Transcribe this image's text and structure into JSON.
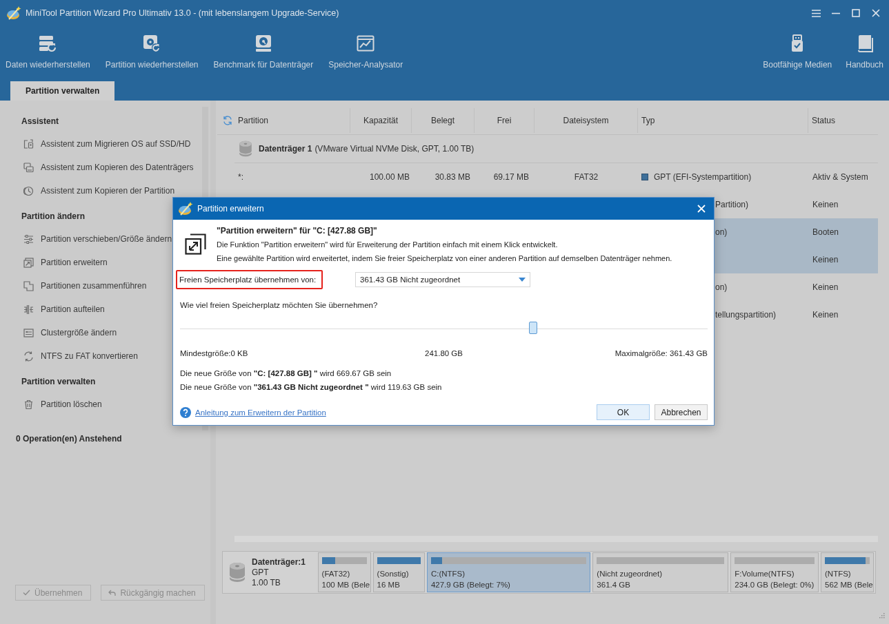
{
  "window": {
    "title": "MiniTool Partition Wizard Pro Ultimativ 13.0 - (mit lebenslangem Upgrade-Service)"
  },
  "toolbar": {
    "left": [
      {
        "label": "Daten wiederherstellen",
        "kind": "data"
      },
      {
        "label": "Partition wiederherstellen",
        "kind": "partition"
      },
      {
        "label": "Benchmark für Datenträger",
        "kind": "benchmark"
      },
      {
        "label": "Speicher-Analysator",
        "kind": "analyzer"
      }
    ],
    "right": [
      {
        "label": "Bootfähige Medien",
        "kind": "bootable"
      },
      {
        "label": "Handbuch",
        "kind": "manual"
      }
    ]
  },
  "tabs": [
    {
      "label": "Partition verwalten",
      "selected": true
    }
  ],
  "sidebar": {
    "sections": [
      {
        "title": "Assistent",
        "items": [
          {
            "label": "Assistent zum Migrieren OS auf SSD/HD",
            "kind": "migrate"
          },
          {
            "label": "Assistent zum Kopieren des Datenträgers",
            "kind": "copy-disk"
          },
          {
            "label": "Assistent zum Kopieren der Partition",
            "kind": "copy-partition"
          }
        ]
      },
      {
        "title": "Partition ändern",
        "items": [
          {
            "label": "Partition verschieben/Größe ändern",
            "kind": "move-resize"
          },
          {
            "label": "Partition erweitern",
            "kind": "extend"
          },
          {
            "label": "Partitionen zusammenführen",
            "kind": "merge"
          },
          {
            "label": "Partition aufteilen",
            "kind": "split"
          },
          {
            "label": "Clustergröße ändern",
            "kind": "cluster"
          },
          {
            "label": "NTFS zu FAT konvertieren",
            "kind": "convert"
          }
        ]
      },
      {
        "title": "Partition verwalten",
        "items": [
          {
            "label": "Partition löschen",
            "kind": "delete"
          }
        ]
      }
    ],
    "pending": "0 Operation(en) Anstehend",
    "buttons": [
      {
        "label": "Übernehmen",
        "kind": "apply",
        "disabled": true
      },
      {
        "label": "Rückgängig machen",
        "kind": "undo",
        "disabled": true
      }
    ]
  },
  "table": {
    "columns": [
      "Partition",
      "Kapazität",
      "Belegt",
      "Frei",
      "Dateisystem",
      "Typ",
      "Status"
    ],
    "disk": {
      "name": "Datenträger 1",
      "detail": "(VMware Virtual NVMe Disk, GPT, 1.00 TB)"
    },
    "rows": [
      {
        "partition": "*:",
        "capacity": "100.00 MB",
        "used": "30.83 MB",
        "free": "69.17 MB",
        "filesystem": "FAT32",
        "type": "GPT (EFI-Systempartition)",
        "status": "Aktiv & System",
        "selected": false
      },
      {
        "type": "Partition)",
        "status": "Keinen",
        "selected": false
      },
      {
        "type": "on)",
        "status": "Booten",
        "selected": true
      },
      {
        "status": "Keinen",
        "selected": true
      },
      {
        "type": "on)",
        "status": "Keinen",
        "selected": false
      },
      {
        "type": "tellungspartition)",
        "status": "Keinen",
        "selected": false
      }
    ]
  },
  "disk_map": {
    "name": "Datenträger:1",
    "scheme": "GPT",
    "size": "1.00 TB",
    "partitions": [
      {
        "label": "(FAT32)",
        "detail": "100 MB (Bele",
        "level": 0.3,
        "selected": false
      },
      {
        "label": "(Sonstig)",
        "detail": "16 MB",
        "level": 1,
        "selected": false
      },
      {
        "label": "C:(NTFS)",
        "detail": "427.9 GB (Belegt: 7%)",
        "level": 0.07,
        "selected": true
      },
      {
        "label": "(Nicht zugeordnet)",
        "detail": "361.4 GB",
        "selected": false
      },
      {
        "label": "F:Volume(NTFS)",
        "detail": "234.0 GB (Belegt: 0%)",
        "selected": false
      },
      {
        "label": "(NTFS)",
        "detail": "562 MB (Bele",
        "level": 0.9,
        "selected": false
      }
    ]
  },
  "dialog": {
    "title": "Partition erweitern",
    "heading": "\"Partition erweitern\" für \"C: [427.88 GB]\"",
    "description": [
      "Die Funktion \"Partition erweitern\" wird für Erweiterung der Partition einfach mit einem Klick entwickelt.",
      "Eine gewählte Partition wird erweitertet, indem Sie freier Speicherplatz von einer anderen Partition auf demselben Datenträger nehmen."
    ],
    "source": {
      "label": "Freien Speicherplatz übernehmen von:",
      "highlighted": true,
      "value": "361.43 GB Nicht zugeordnet"
    },
    "question": "Wie viel freien Speicherplatz möchten Sie übernehmen?",
    "slider": {
      "level": 0.669
    },
    "min_label": "Mindestgröße:0 KB",
    "current": "241.80 GB",
    "max_label": "Maximalgröße: 361.43 GB",
    "results": [
      "Die neue Größe von **\"C: [427.88 GB] \"** wird 669.67 GB sein",
      "Die neue Größe von **\"361.43 GB Nicht zugeordnet \"** wird 119.63 GB sein"
    ],
    "help_link": "Anleitung zum Erweitern der Partition",
    "buttons": [
      {
        "label": "OK",
        "kind": "primary"
      },
      {
        "label": "Abbrechen",
        "kind": "secondary"
      }
    ]
  }
}
